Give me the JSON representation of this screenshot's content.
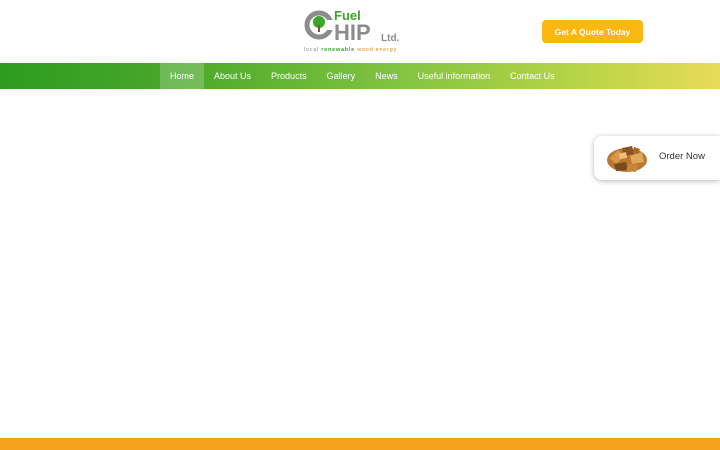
{
  "logo": {
    "word_fuel": "Fuel",
    "word_chip_c": "C",
    "word_chip_rest": "HIP",
    "word_ltd": "Ltd.",
    "tagline_local": "local",
    "tagline_renewable": "renewable",
    "tagline_wood": "wood energy"
  },
  "header": {
    "quote_button": "Get A Quote Today"
  },
  "nav": {
    "items": [
      {
        "label": "Home",
        "active": true
      },
      {
        "label": "About Us"
      },
      {
        "label": "Products"
      },
      {
        "label": "Gallery"
      },
      {
        "label": "News"
      },
      {
        "label": "Useful information"
      },
      {
        "label": "Contact Us"
      }
    ]
  },
  "order_widget": {
    "label": "Order Now",
    "image": "wood-chips-icon"
  },
  "colors": {
    "accent_orange": "#fcb713",
    "nav_green": "#2d9c1f",
    "nav_yellow": "#e9da5a",
    "footer_orange": "#f5a31e"
  }
}
